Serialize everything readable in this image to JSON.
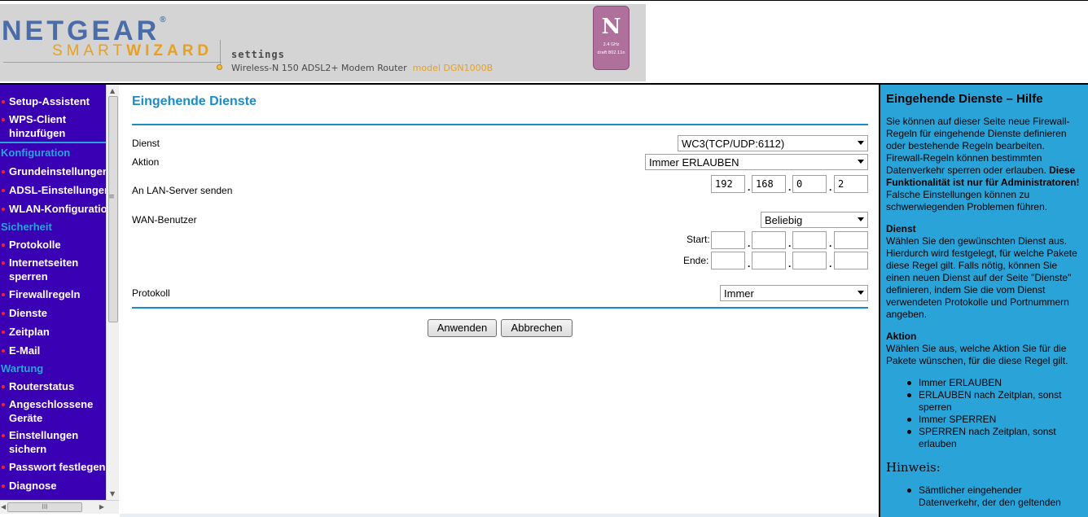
{
  "header": {
    "brand": "NETGEAR",
    "brand_reg": "®",
    "smart_a": "SMART",
    "smart_b": "WIZARD",
    "settings": "settings",
    "product": "Wireless-N 150 ADSL2+ Modem Router",
    "model": "model DGN1000B",
    "badge_letter": "N",
    "badge_sub1": "2.4 GHz",
    "badge_sub2": "draft 802.11n"
  },
  "nav": {
    "items_top": [
      {
        "label": "Setup-Assistent"
      },
      {
        "label": "WPS-Client hinzufügen"
      }
    ],
    "section_konfiguration": "Konfiguration",
    "items_konfiguration": [
      {
        "label": "Grundeinstellungen"
      },
      {
        "label": "ADSL-Einstellungen"
      },
      {
        "label": "WLAN-Konfiguration"
      }
    ],
    "section_sicherheit": "Sicherheit",
    "items_sicherheit": [
      {
        "label": "Protokolle"
      },
      {
        "label": "Internetseiten sperren"
      },
      {
        "label": "Firewallregeln"
      },
      {
        "label": "Dienste"
      },
      {
        "label": "Zeitplan"
      },
      {
        "label": "E-Mail"
      }
    ],
    "section_wartung": "Wartung",
    "items_wartung": [
      {
        "label": "Routerstatus"
      },
      {
        "label": "Angeschlossene Geräte"
      },
      {
        "label": "Einstellungen sichern"
      },
      {
        "label": "Passwort festlegen"
      },
      {
        "label": "Diagnose"
      }
    ]
  },
  "main": {
    "title": "Eingehende Dienste",
    "dienst_label": "Dienst",
    "dienst_value": "WC3(TCP/UDP:6112)",
    "aktion_label": "Aktion",
    "aktion_value": "Immer ERLAUBEN",
    "lan_label": "An LAN-Server senden",
    "lan_ip": [
      "192",
      "168",
      "0",
      "2"
    ],
    "wan_label": "WAN-Benutzer",
    "wan_value": "Beliebig",
    "start_label": "Start:",
    "ende_label": "Ende:",
    "protokoll_label": "Protokoll",
    "protokoll_value": "Immer",
    "apply_button": "Anwenden",
    "cancel_button": "Abbrechen"
  },
  "help": {
    "title": "Eingehende Dienste – Hilfe",
    "intro_normal": "Sie können auf dieser Seite neue Firewall-Regeln für eingehende Dienste definieren oder bestehende Regeln bearbeiten. Firewall-Regeln können bestimmten Datenverkehr sperren oder erlauben.",
    "intro_bold": "Diese Funktionalität ist nur für Administratoren!",
    "intro_tail": "Falsche Einstellungen können zu schwerwiegenden Problemen führen.",
    "dienst_heading": "Dienst",
    "dienst_text": "Wählen Sie den gewünschten Dienst aus. Hierdurch wird festgelegt, für welche Pakete diese Regel gilt. Falls nötig, können Sie einen neuen Dienst auf der Seite \"Dienste\" definieren, indem Sie die vom Dienst verwendeten Protokolle und Portnummern angeben.",
    "aktion_heading": "Aktion",
    "aktion_text": "Wählen Sie aus, welche Aktion Sie für die Pakete wünschen, für die diese Regel gilt.",
    "aktion_options": [
      "Immer ERLAUBEN",
      "ERLAUBEN nach Zeitplan, sonst sperren",
      "Immer SPERREN",
      "SPERREN nach Zeitplan, sonst erlauben"
    ],
    "hinweis_heading": "Hinweis:",
    "hinweis_items": [
      "Sämtlicher eingehender Datenverkehr, der den geltenden"
    ]
  },
  "colors": {
    "nav_bg": "#3a00b4",
    "accent_blue": "#1a8cc8",
    "help_bg": "#2aa4d8",
    "nav_bullet": "#ff2020",
    "brand_blue": "#4a6ca8",
    "brand_orange": "#e8a020"
  }
}
